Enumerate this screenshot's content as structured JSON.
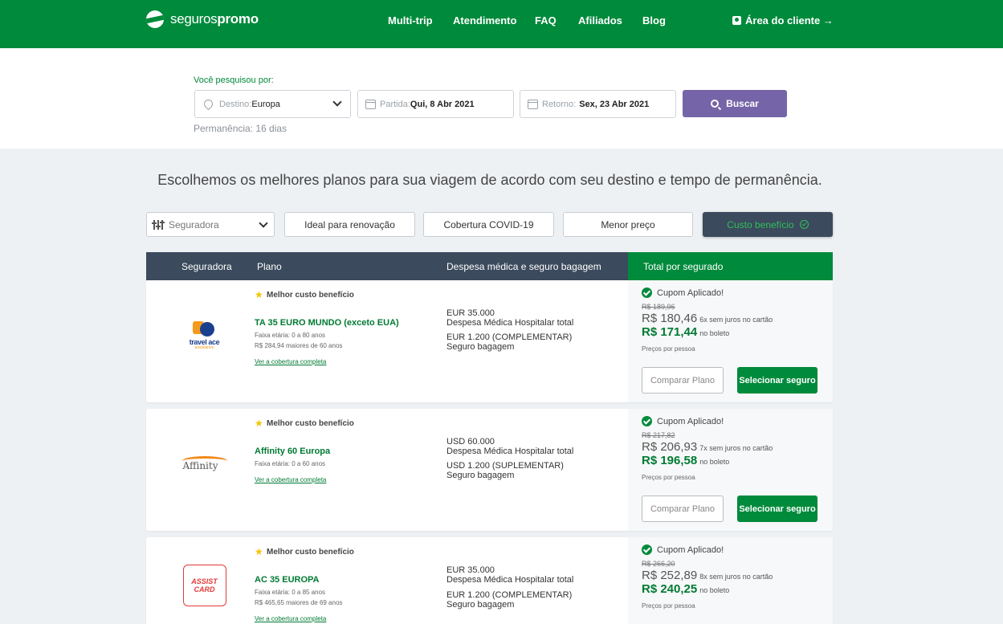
{
  "header": {
    "brand_prefix": "seguros",
    "brand_suffix": "promo",
    "nav": [
      "Multi-trip",
      "Atendimento",
      "FAQ",
      "Afiliados",
      "Blog"
    ],
    "client_area": "Área do cliente →"
  },
  "search": {
    "label": "Você pesquisou por:",
    "destination_label": "Destino:",
    "destination_value": "Europa",
    "departure_label": "Partida:",
    "departure_value": "Qui, 8 Abr 2021",
    "return_label": "Retorno:",
    "return_value": "Sex, 23 Abr 2021",
    "button": "Buscar",
    "stay": "Permanência: 16 dias"
  },
  "headline": "Escolhemos os melhores planos para sua viagem de acordo com seu destino e tempo de permanência.",
  "filters": {
    "insurer_select": "Seguradora",
    "renewal": "Ideal para renovação",
    "covid": "Cobertura COVID-19",
    "lowest_price": "Menor preço",
    "best_value": "Custo benefício"
  },
  "table_header": {
    "insurer": "Seguradora",
    "plan": "Plano",
    "coverage": "Despesa médica e seguro bagagem",
    "total": "Total por segurado"
  },
  "plans": [
    {
      "badge": "Melhor custo benefício",
      "logo": "travel ace assistance",
      "logo_text": "travel ace",
      "logo_sub": "assistance",
      "name": "TA 35 EURO MUNDO (exceto EUA)",
      "age": "Faixa etária: 0 a 80 anos",
      "age_extra": "R$ 284,94 maiores de 60 anos",
      "link": "Ver a cobertura completa",
      "medical_amount": "EUR 35.000",
      "medical_label": "Despesa Médica Hospitalar total",
      "baggage_amount": "EUR 1.200 (COMPLEMENTAR)",
      "baggage_label": "Seguro bagagem",
      "coupon": "Cupom Aplicado!",
      "old_price": "R$ 189,96",
      "card_price": "R$ 180,46",
      "card_note": "6x sem juros no cartão",
      "boleto_price": "R$ 171,44",
      "boleto_note": "no boleto",
      "per_person": "Preços por pessoa",
      "compare": "Comparar Plano",
      "select": "Selecionar seguro"
    },
    {
      "badge": "Melhor custo benefício",
      "logo": "Affinity",
      "logo_text": "Affinity",
      "name": "Affinity 60 Europa",
      "age": "Faixa etária: 0 a 60 anos",
      "link": "Ver a cobertura completa",
      "medical_amount": "USD 60.000",
      "medical_label": "Despesa Médica Hospitalar total",
      "baggage_amount": "USD 1.200 (SUPLEMENTAR)",
      "baggage_label": "Seguro bagagem",
      "coupon": "Cupom Aplicado!",
      "old_price": "R$ 217,82",
      "card_price": "R$ 206,93",
      "card_note": "7x sem juros no cartão",
      "boleto_price": "R$ 196,58",
      "boleto_note": "no boleto",
      "per_person": "Preços por pessoa",
      "compare": "Comparar Plano",
      "select": "Selecionar seguro"
    },
    {
      "badge": "Melhor custo benefício",
      "logo": "ASSIST CARD",
      "logo_line1": "ASSIST",
      "logo_line2": "CARD",
      "name": "AC 35 EUROPA",
      "age": "Faixa etária: 0 a 85 anos",
      "age_extra": "R$ 465,65 maiores de 69 anos",
      "link": "Ver a cobertura completa",
      "medical_amount": "EUR 35.000",
      "medical_label": "Despesa Médica Hospitalar total",
      "baggage_amount": "EUR 1.200 (COMPLEMENTAR)",
      "baggage_label": "Seguro bagagem",
      "coupon": "Cupom Aplicado!",
      "old_price": "R$ 266,20",
      "card_price": "R$ 252,89",
      "card_note": "8x sem juros no cartão",
      "boleto_price": "R$ 240,25",
      "boleto_note": "no boleto",
      "per_person": "Preços por pessoa"
    }
  ],
  "colors": {
    "brand_green": "#008a3b",
    "dark_slate": "#3b4a5c",
    "search_purple": "#7565a8",
    "price_green": "#007a33"
  }
}
